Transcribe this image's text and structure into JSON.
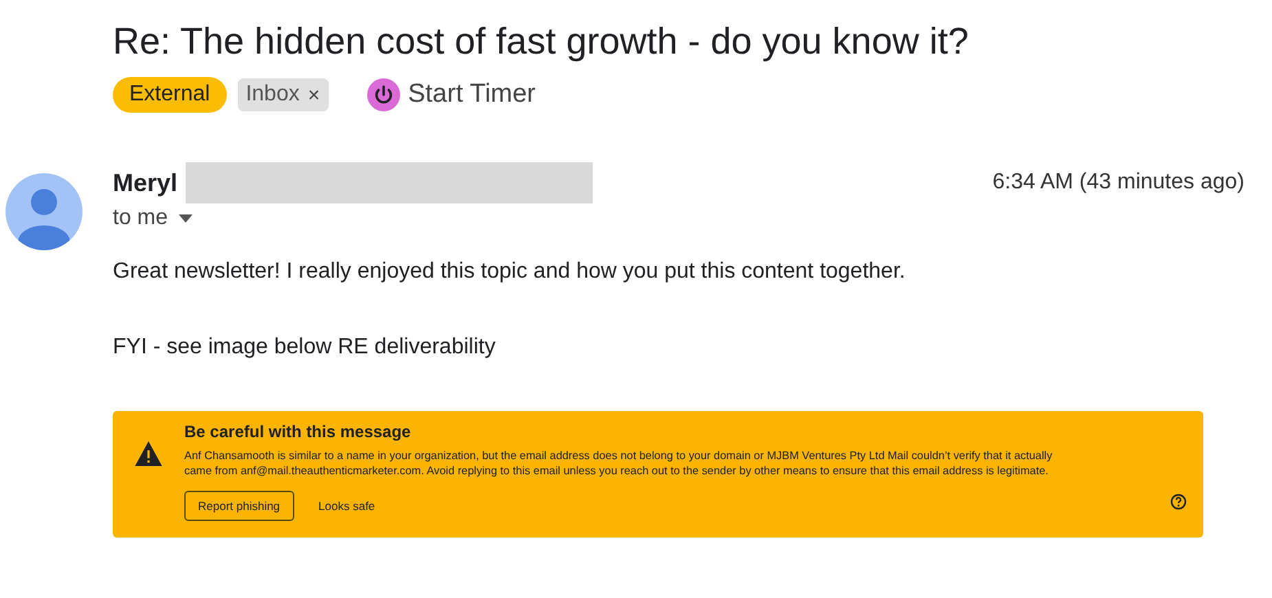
{
  "subject": "Re: The hidden cost of fast growth - do you know it?",
  "labels": [
    {
      "text": "External",
      "kind": "badge"
    },
    {
      "text": "Inbox",
      "kind": "chip",
      "close": "×"
    }
  ],
  "timer": {
    "label": "Start Timer"
  },
  "message": {
    "sender": "Meryl",
    "time": "6:34 AM (43 minutes ago)",
    "recipient": "to me",
    "body": [
      "Great newsletter! I really enjoyed this topic and how you put this content together.",
      "FYI - see image below RE deliverability"
    ]
  },
  "warning": {
    "title": "Be careful with this message",
    "text": "Anf Chansamooth is similar to a name in your organization, but the email address does not belong to your domain or MJBM Ventures Pty Ltd Mail couldn’t verify that it actually came from anf@mail.theauthenticmarketer.com. Avoid replying to this email unless you reach out to the sender by other means to ensure that this email address is legitimate.",
    "buttons": [
      {
        "label": "Report phishing",
        "kind": "outlined"
      },
      {
        "label": "Looks safe",
        "kind": "text"
      }
    ]
  }
}
